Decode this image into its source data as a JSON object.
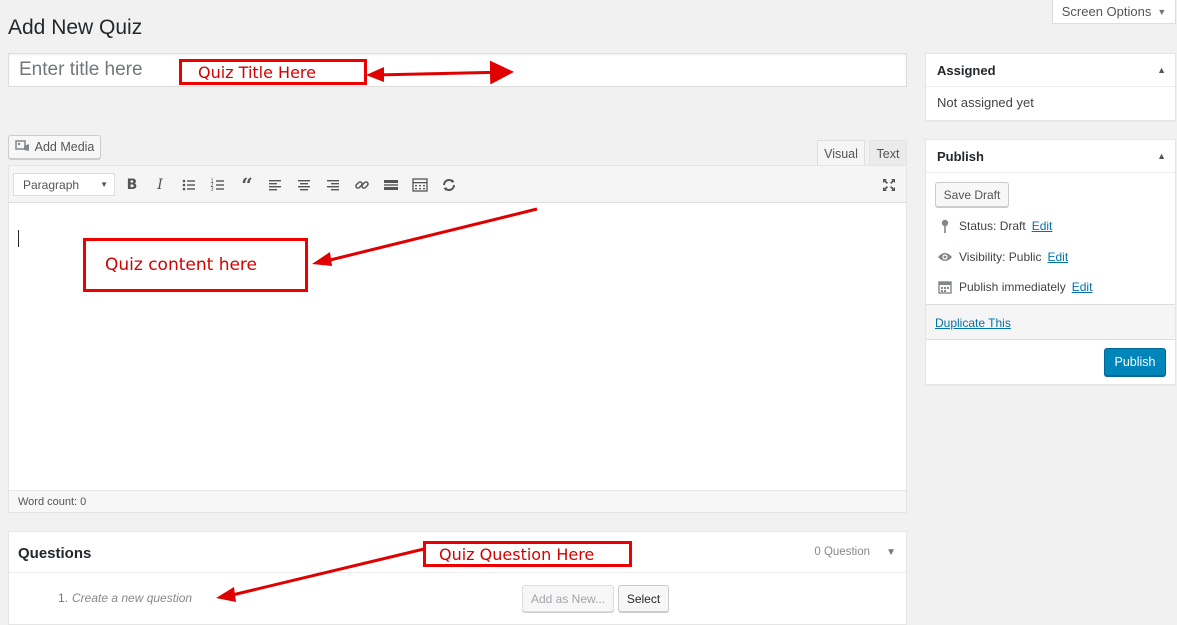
{
  "header": {
    "page_title": "Add New Quiz",
    "screen_options_label": "Screen Options"
  },
  "title_field": {
    "placeholder": "Enter title here",
    "value": ""
  },
  "editor": {
    "add_media_label": "Add Media",
    "tabs": [
      {
        "label": "Visual",
        "active": true
      },
      {
        "label": "Text",
        "active": false
      }
    ],
    "format_select": "Paragraph",
    "toolbar_icons": [
      "bold-icon",
      "italic-icon",
      "bulleted-list-icon",
      "numbered-list-icon",
      "blockquote-icon",
      "align-left-icon",
      "align-center-icon",
      "align-right-icon",
      "link-icon",
      "read-more-icon",
      "toolbar-toggle-icon",
      "refresh-icon",
      "fullscreen-icon"
    ],
    "word_count": "Word count: 0"
  },
  "questions": {
    "title": "Questions",
    "count": "0 Question",
    "row_number": "1.",
    "row_placeholder": "Create a new question",
    "add_new_label": "Add as New...",
    "select_label": "Select"
  },
  "sidebar": {
    "assigned": {
      "title": "Assigned",
      "text": "Not assigned yet"
    },
    "publish": {
      "title": "Publish",
      "save_draft_label": "Save Draft",
      "status_label": "Status: Draft",
      "visibility_label": "Visibility: Public",
      "schedule_label": "Publish immediately",
      "edit_label": "Edit",
      "duplicate_label": "Duplicate This",
      "publish_label": "Publish"
    }
  },
  "annotations": {
    "title_note": "Quiz Title Here",
    "content_note": "Quiz content here",
    "question_note": "Quiz Question Here",
    "color": "#e00000"
  },
  "colors": {
    "background": "#f1f1f1",
    "primary_button": "#0085ba",
    "link": "#0073aa"
  }
}
